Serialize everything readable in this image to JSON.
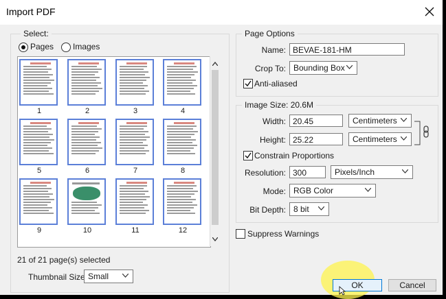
{
  "window": {
    "title": "Import PDF"
  },
  "select": {
    "legend": "Select:",
    "pages_label": "Pages",
    "images_label": "Images",
    "pages": [
      "1",
      "2",
      "3",
      "4",
      "5",
      "6",
      "7",
      "8",
      "9",
      "10",
      "11",
      "12"
    ],
    "status": "21 of 21 page(s) selected",
    "thumbnail_size_label": "Thumbnail Size:",
    "thumbnail_size_value": "Small"
  },
  "page_options": {
    "legend": "Page Options",
    "name_label": "Name:",
    "name_value": "BEVAE-181-HM",
    "crop_label": "Crop To:",
    "crop_value": "Bounding Box",
    "anti_aliased_label": "Anti-aliased"
  },
  "image_size": {
    "legend": "Image Size: 20.6M",
    "width_label": "Width:",
    "width_value": "20.45",
    "width_unit": "Centimeters",
    "height_label": "Height:",
    "height_value": "25.22",
    "height_unit": "Centimeters",
    "constrain_label": "Constrain Proportions",
    "resolution_label": "Resolution:",
    "resolution_value": "300",
    "resolution_unit": "Pixels/Inch",
    "mode_label": "Mode:",
    "mode_value": "RGB Color",
    "bit_depth_label": "Bit Depth:",
    "bit_depth_value": "8 bit"
  },
  "suppress_warnings_label": "Suppress Warnings",
  "buttons": {
    "ok": "OK",
    "cancel": "Cancel"
  },
  "colors": {
    "thumbnail_border": "#5b7fd8",
    "ok_border": "#0078d7",
    "highlight": "#fff44f"
  }
}
